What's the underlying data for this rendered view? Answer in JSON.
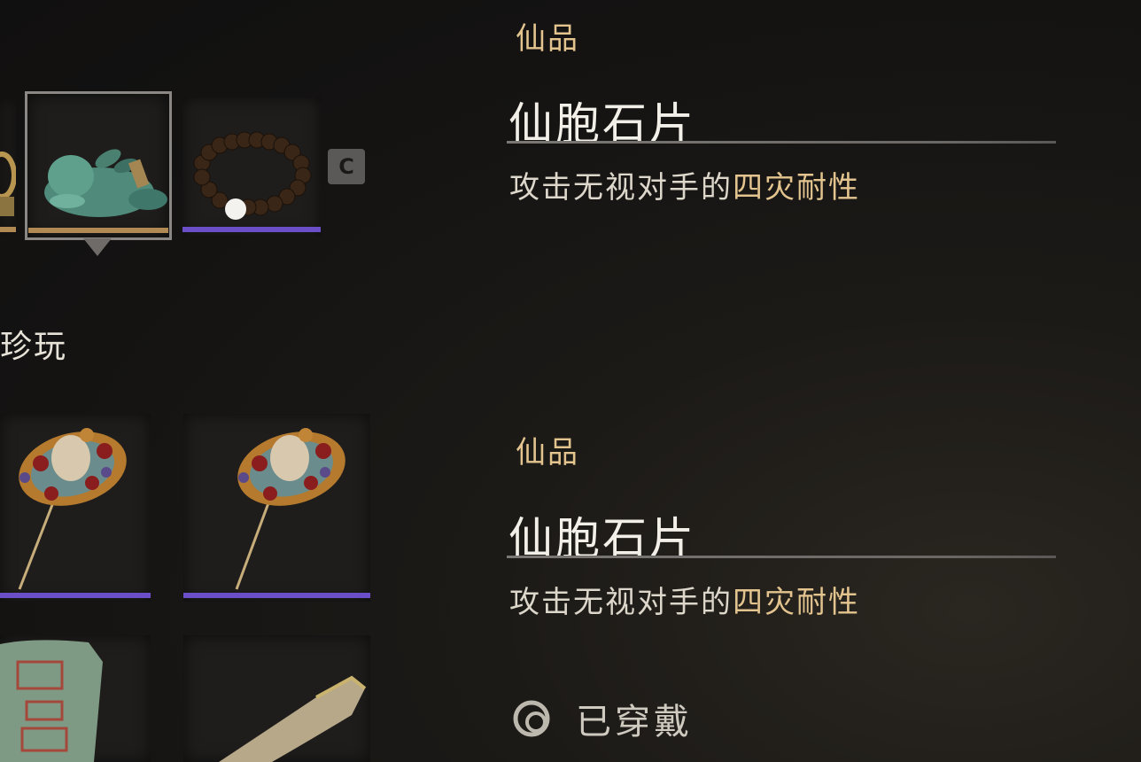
{
  "top_row": {
    "key_hint": "C"
  },
  "section": {
    "label": "珍玩"
  },
  "details": [
    {
      "rarity": "仙品",
      "name": "仙胞石片",
      "desc_prefix": "攻击无视对手的",
      "desc_highlight": "四灾耐性"
    },
    {
      "rarity": "仙品",
      "name": "仙胞石片",
      "desc_prefix": "攻击无视对手的",
      "desc_highlight": "四灾耐性"
    }
  ],
  "status": {
    "label": "已穿戴",
    "icon": "equipped-ring-icon"
  },
  "colors": {
    "rarity_gold": "#e3c48f",
    "quality_purple": "#6a4fc8",
    "quality_gold": "#b08a52"
  },
  "icons": [
    "gold-ring-icon",
    "jade-rabbit-icon",
    "prayer-beads-icon",
    "hairpin-icon",
    "hairpin-icon",
    "jade-seal-icon",
    "bone-flute-icon"
  ]
}
